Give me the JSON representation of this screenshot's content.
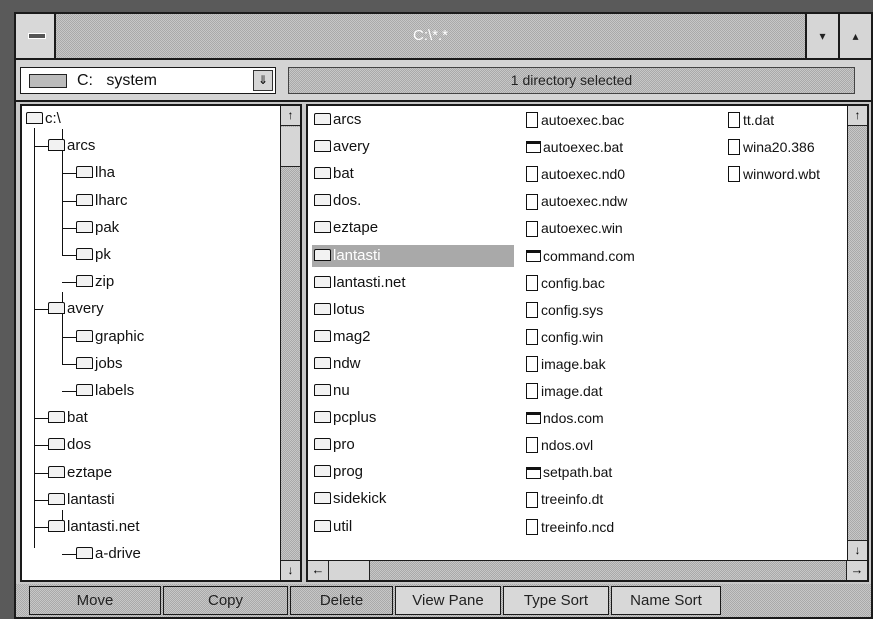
{
  "window": {
    "title": "C:\\*.*"
  },
  "titlebar": {
    "minimize_glyph": "▾",
    "maximize_glyph": "▴"
  },
  "drive": {
    "selected": "C:   system",
    "dropdown_glyph": "⇓"
  },
  "status": {
    "text": "1 directory selected"
  },
  "scroll": {
    "up": "↑",
    "down": "↓",
    "left": "←",
    "right": "→"
  },
  "tree": {
    "root": "c:\\",
    "nodes": [
      "arcs",
      "lha",
      "lharc",
      "pak",
      "pk",
      "zip",
      "avery",
      "graphic",
      "jobs",
      "labels",
      "bat",
      "dos",
      "eztape",
      "lantasti",
      "lantasti.net",
      "a-drive"
    ]
  },
  "files": {
    "col1": [
      "arcs",
      "avery",
      "bat",
      "dos.",
      "eztape",
      "lantasti",
      "lantasti.net",
      "lotus",
      "mag2",
      "ndw",
      "nu",
      "pcplus",
      "pro",
      "prog",
      "sidekick",
      "util"
    ],
    "col2": [
      "autoexec.bac",
      "autoexec.bat",
      "autoexec.nd0",
      "autoexec.ndw",
      "autoexec.win",
      "command.com",
      "config.bac",
      "config.sys",
      "config.win",
      "image.bak",
      "image.dat",
      "ndos.com",
      "ndos.ovl",
      "setpath.bat",
      "treeinfo.dt",
      "treeinfo.ncd"
    ],
    "col2_icons": [
      "doc",
      "exe",
      "doc",
      "doc",
      "doc",
      "exe",
      "doc",
      "doc",
      "doc",
      "doc",
      "doc",
      "exe",
      "doc",
      "exe",
      "doc",
      "doc"
    ],
    "col3": [
      "tt.dat",
      "wina20.386",
      "winword.wbt"
    ],
    "selected_index": 5
  },
  "buttons": {
    "move": "Move",
    "copy": "Copy",
    "delete": "Delete",
    "view_pane": "View Pane",
    "type_sort": "Type Sort",
    "name_sort": "Name Sort"
  }
}
